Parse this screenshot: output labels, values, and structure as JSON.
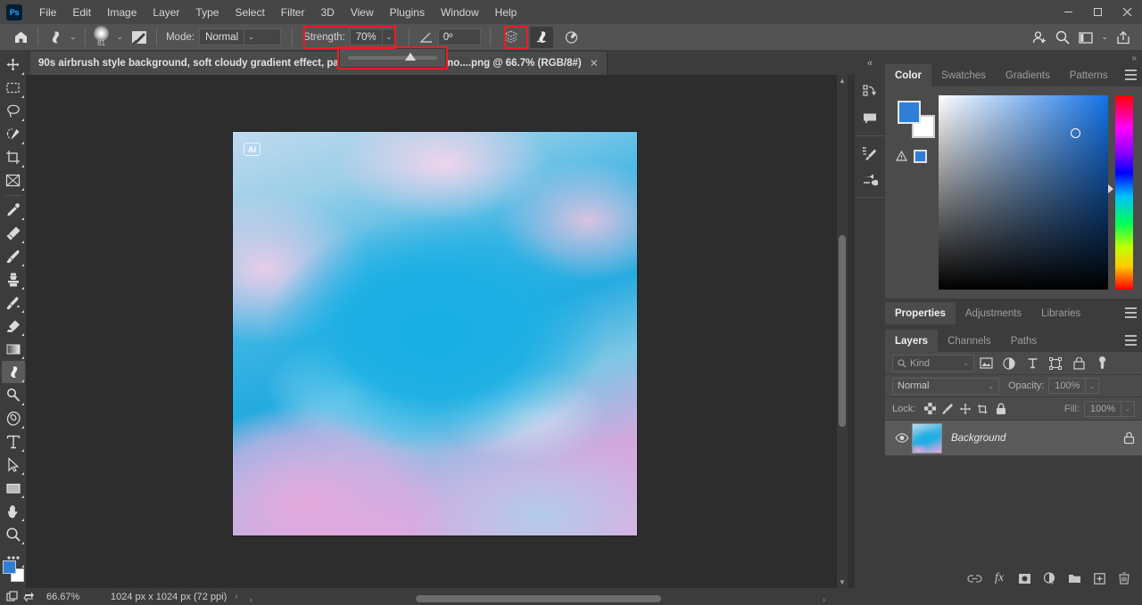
{
  "app": {
    "logo": "Ps",
    "name": "Adobe Photoshop"
  },
  "menubar": {
    "items": [
      "File",
      "Edit",
      "Image",
      "Layer",
      "Type",
      "Select",
      "Filter",
      "3D",
      "View",
      "Plugins",
      "Window",
      "Help"
    ],
    "window_buttons": {
      "minimize": "—",
      "maximize": "❑",
      "close": "✕"
    }
  },
  "options_bar": {
    "home_icon": "home-icon",
    "tool_icon": "smudge-tool-icon",
    "tool_arrow": "⌄",
    "brush_size": "81",
    "brush_preset_icon": "brush-preset-icon",
    "mode_label": "Mode:",
    "mode_value": "Normal",
    "mode_arrow": "⌄",
    "strength_label": "Strength:",
    "strength_value": "70%",
    "strength_arrow": "⌄",
    "angle_icon": "angle-icon",
    "angle_value": "0º",
    "sample_all_layers_icon": "sample-all-layers-icon",
    "finger_painting_icon": "finger-painting-icon",
    "pressure_tablet_icon": "pressure-for-size-icon",
    "right_icons": [
      "share-user-icon",
      "search-icon",
      "workspace-icon",
      "workspace-chevron-icon",
      "share-export-icon"
    ],
    "slider": {
      "name": "strength-slider",
      "value": 70
    },
    "highlight_color": "#ee1c25"
  },
  "document_tab": {
    "title": "90s airbrush style background, soft cloudy gradient effect, pastel colors, dreamy atmo....png @ 66.7% (RGB/8#)",
    "close": "✕",
    "arrange_arrows": "»"
  },
  "toolbar": {
    "tools": [
      {
        "name": "move-tool",
        "label": "Move Tool"
      },
      {
        "name": "rectangular-marquee-tool",
        "label": "Rectangular Marquee Tool"
      },
      {
        "name": "lasso-tool",
        "label": "Lasso Tool"
      },
      {
        "name": "object-selection-tool",
        "label": "Object Selection Tool"
      },
      {
        "name": "crop-tool",
        "label": "Crop Tool"
      },
      {
        "name": "frame-tool",
        "label": "Frame Tool"
      },
      {
        "name": "eyedropper-tool",
        "label": "Eyedropper Tool"
      },
      {
        "name": "spot-healing-brush-tool",
        "label": "Spot Healing Brush Tool"
      },
      {
        "name": "brush-tool",
        "label": "Brush Tool"
      },
      {
        "name": "clone-stamp-tool",
        "label": "Clone Stamp Tool"
      },
      {
        "name": "history-brush-tool",
        "label": "History Brush Tool"
      },
      {
        "name": "eraser-tool",
        "label": "Eraser Tool"
      },
      {
        "name": "gradient-tool",
        "label": "Gradient Tool"
      },
      {
        "name": "smudge-tool",
        "label": "Smudge Tool",
        "selected": true
      },
      {
        "name": "dodge-tool",
        "label": "Dodge Tool"
      },
      {
        "name": "pen-tool",
        "label": "Pen Tool"
      },
      {
        "name": "horizontal-type-tool",
        "label": "Horizontal Type Tool"
      },
      {
        "name": "path-selection-tool",
        "label": "Path Selection Tool"
      },
      {
        "name": "rectangle-tool",
        "label": "Rectangle Tool"
      },
      {
        "name": "hand-tool",
        "label": "Hand Tool"
      },
      {
        "name": "zoom-tool",
        "label": "Zoom Tool"
      },
      {
        "name": "edit-toolbar-tool",
        "label": "Edit Toolbar"
      }
    ],
    "foreground_color": "#2f7ed8",
    "background_color": "#ffffff"
  },
  "canvas": {
    "ai_badge": "AI",
    "image_description": "Pastel airbrush sky with cyan center and pink clouds"
  },
  "dock_strip": {
    "icons": [
      "history-icon",
      "comments-icon",
      "brush-settings-icon",
      "brushes-icon"
    ],
    "collapse": "«"
  },
  "panels": {
    "collapse": "»",
    "color": {
      "tabs": [
        {
          "label": "Color",
          "active": true
        },
        {
          "label": "Swatches",
          "active": false
        },
        {
          "label": "Gradients",
          "active": false
        },
        {
          "label": "Patterns",
          "active": false
        }
      ],
      "foreground": "#2f7ed8",
      "background": "#ffffff",
      "menu": "panel-menu-icon"
    },
    "properties": {
      "tabs": [
        {
          "label": "Properties",
          "active": true
        },
        {
          "label": "Adjustments",
          "active": false
        },
        {
          "label": "Libraries",
          "active": false
        }
      ]
    },
    "layers": {
      "tabs": [
        {
          "label": "Layers",
          "active": true
        },
        {
          "label": "Channels",
          "active": false
        },
        {
          "label": "Paths",
          "active": false
        }
      ],
      "filter_kind": "Kind",
      "filter_icons": [
        "filter-pixel-icon",
        "filter-adjustment-icon",
        "filter-type-icon",
        "filter-shape-icon",
        "filter-smart-object-icon",
        "filter-toggle-icon"
      ],
      "blend_mode": "Normal",
      "opacity_label": "Opacity:",
      "opacity_value": "100%",
      "lock_label": "Lock:",
      "lock_icons": [
        "lock-transparent-pixels-icon",
        "lock-image-pixels-icon",
        "lock-position-icon",
        "lock-artboard-nesting-icon",
        "lock-all-icon"
      ],
      "fill_label": "Fill:",
      "fill_value": "100%",
      "rows": [
        {
          "name": "Background",
          "visible": true,
          "locked": true,
          "selected": true
        }
      ],
      "bottom_icons": [
        "link-layers-icon",
        "layer-style-fx-icon",
        "layer-mask-icon",
        "new-fill-adjustment-icon",
        "new-group-icon",
        "new-layer-icon",
        "delete-layer-icon"
      ],
      "fx_label": "fx"
    }
  },
  "statusbar": {
    "icons": [
      "document-icon",
      "rotate-icon"
    ],
    "zoom": "66.67%",
    "doc_size": "1024 px x 1024 px (72 ppi)",
    "expand_arrow": "›",
    "scroll_left": "‹",
    "scroll_right": "›"
  }
}
